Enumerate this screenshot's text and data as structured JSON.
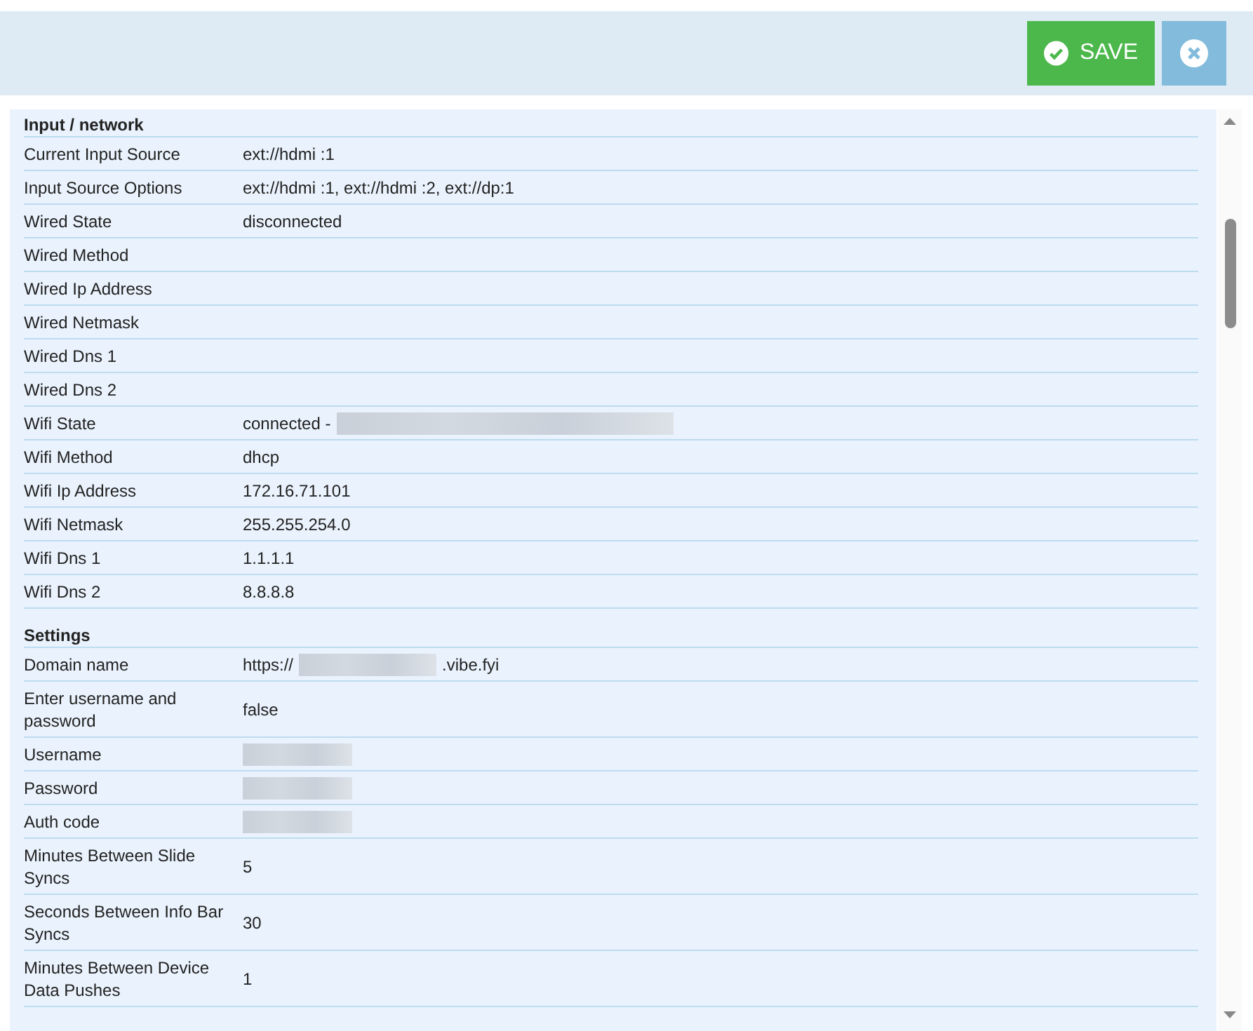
{
  "toolbar": {
    "save_button": "SAVE"
  },
  "sections": [
    {
      "title": "Input / network",
      "rows": [
        {
          "label": "Current Input Source",
          "value": [
            {
              "kind": "text",
              "text": "ext://hdmi :1"
            }
          ]
        },
        {
          "label": "Input Source Options",
          "value": [
            {
              "kind": "text",
              "text": "ext://hdmi :1, ext://hdmi :2, ext://dp:1"
            }
          ]
        },
        {
          "label": "Wired State",
          "value": [
            {
              "kind": "text",
              "text": "disconnected"
            }
          ]
        },
        {
          "label": "Wired Method",
          "value": []
        },
        {
          "label": "Wired Ip Address",
          "value": []
        },
        {
          "label": "Wired Netmask",
          "value": []
        },
        {
          "label": "Wired Dns 1",
          "value": []
        },
        {
          "label": "Wired Dns 2",
          "value": []
        },
        {
          "label": "Wifi State",
          "value": [
            {
              "kind": "text",
              "text": "connected -"
            },
            {
              "kind": "redacted_wide"
            }
          ]
        },
        {
          "label": "Wifi Method",
          "value": [
            {
              "kind": "text",
              "text": "dhcp"
            }
          ]
        },
        {
          "label": "Wifi Ip Address",
          "value": [
            {
              "kind": "text",
              "text": "172.16.71.101"
            }
          ]
        },
        {
          "label": "Wifi Netmask",
          "value": [
            {
              "kind": "text",
              "text": "255.255.254.0"
            }
          ]
        },
        {
          "label": "Wifi Dns 1",
          "value": [
            {
              "kind": "text",
              "text": "1.1.1.1"
            }
          ]
        },
        {
          "label": "Wifi Dns 2",
          "value": [
            {
              "kind": "text",
              "text": "8.8.8.8"
            }
          ]
        }
      ]
    },
    {
      "title": "Settings",
      "rows": [
        {
          "label": "Domain name",
          "value": [
            {
              "kind": "text",
              "text": "https://"
            },
            {
              "kind": "redacted"
            },
            {
              "kind": "text",
              "text": ".vibe.fyi"
            }
          ]
        },
        {
          "label": "Enter username and password",
          "value": [
            {
              "kind": "text",
              "text": "false"
            }
          ]
        },
        {
          "label": "Username",
          "value": [
            {
              "kind": "redacted_short"
            }
          ]
        },
        {
          "label": "Password",
          "value": [
            {
              "kind": "redacted_short"
            }
          ]
        },
        {
          "label": "Auth code",
          "value": [
            {
              "kind": "redacted_short"
            }
          ]
        },
        {
          "label": "Minutes Between Slide Syncs",
          "value": [
            {
              "kind": "text",
              "text": "5"
            }
          ]
        },
        {
          "label": "Seconds Between Info Bar Syncs",
          "value": [
            {
              "kind": "text",
              "text": "30"
            }
          ]
        },
        {
          "label": "Minutes Between Device Data Pushes",
          "value": [
            {
              "kind": "text",
              "text": "1"
            }
          ]
        }
      ]
    }
  ]
}
